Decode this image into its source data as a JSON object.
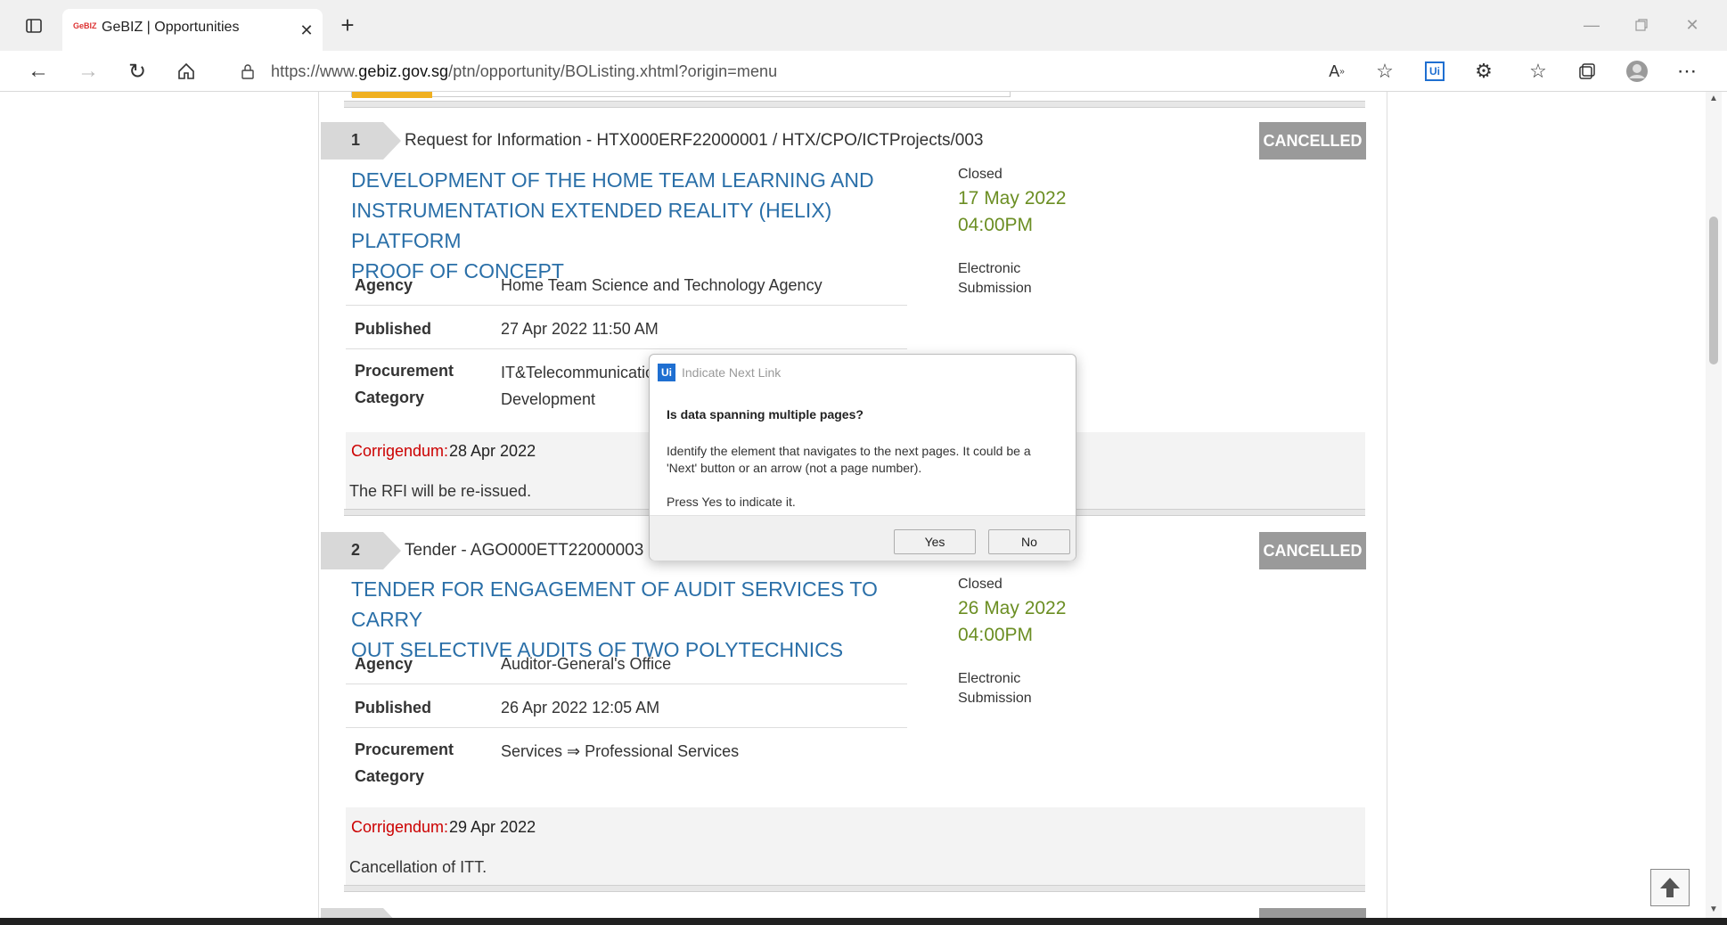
{
  "browser": {
    "tab_title": "GeBIZ | Opportunities",
    "favicon_text": "GeBIZ",
    "url_prefix": "https://www.",
    "url_domain": "gebiz.gov.sg",
    "url_path": "/ptn/opportunity/BOListing.xhtml?origin=menu",
    "ext_badge": "Ui"
  },
  "listings": [
    {
      "number": "1",
      "type_line": "Request for Information - HTX000ERF22000001 / HTX/CPO/ICTProjects/003",
      "status": "CANCELLED",
      "title_lines": [
        "DEVELOPMENT OF THE HOME TEAM LEARNING AND",
        "INSTRUMENTATION EXTENDED REALITY (HELIX) PLATFORM",
        "PROOF OF CONCEPT"
      ],
      "closed_label": "Closed",
      "closed_date": "17 May 2022",
      "closed_time": "04:00PM",
      "submission_lines": [
        "Electronic",
        "Submission"
      ],
      "agency_label": "Agency",
      "agency": "Home Team Science and Technology Agency",
      "published_label": "Published",
      "published": "27 Apr 2022 11:50 AM",
      "procurement_label_1": "Procurement",
      "procurement_label_2": "Category",
      "procurement_1": "IT&Telecommunication ⇒ Software",
      "procurement_2": "Development",
      "corrigendum_label": "Corrigendum:",
      "corrigendum_date": "28 Apr 2022",
      "corrigendum_text": "The RFI will be re-issued."
    },
    {
      "number": "2",
      "type_line": "Tender - AGO000ETT22000003",
      "status": "CANCELLED",
      "title_lines": [
        "TENDER FOR ENGAGEMENT OF AUDIT SERVICES TO CARRY",
        "OUT SELECTIVE AUDITS OF TWO POLYTECHNICS"
      ],
      "closed_label": "Closed",
      "closed_date": "26 May 2022",
      "closed_time": "04:00PM",
      "submission_lines": [
        "Electronic",
        "Submission"
      ],
      "agency_label": "Agency",
      "agency": "Auditor-General's Office",
      "published_label": "Published",
      "published": "26 Apr 2022 12:05 AM",
      "procurement_label_1": "Procurement",
      "procurement_label_2": "Category",
      "procurement_1": "Services ⇒ Professional Services",
      "corrigendum_label": "Corrigendum:",
      "corrigendum_date": "29 Apr 2022",
      "corrigendum_text": "Cancellation of ITT."
    }
  ],
  "dialog": {
    "logo": "Ui",
    "title": "Indicate Next Link",
    "question": "Is data spanning multiple pages?",
    "line1": "Identify the element that navigates to the next pages. It could be a",
    "line2": "'Next' button or an arrow (not a page number).",
    "line3": "Press Yes to indicate it.",
    "yes_label": "Yes",
    "no_label": "No"
  }
}
